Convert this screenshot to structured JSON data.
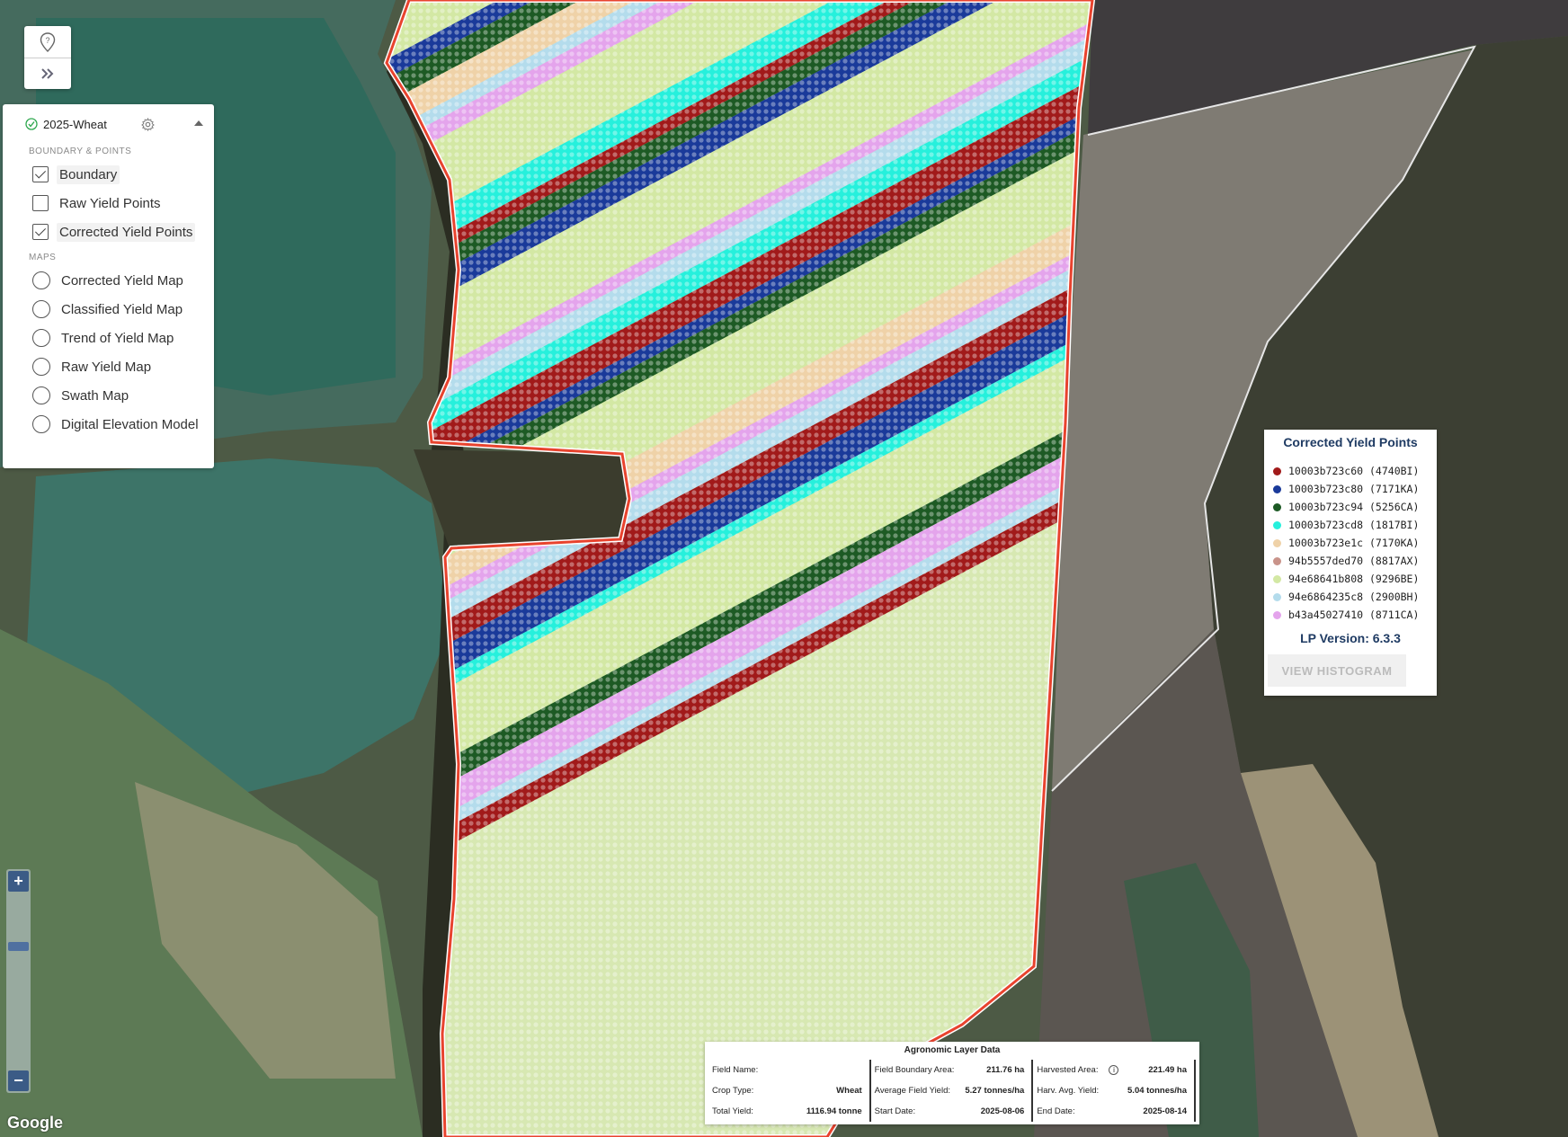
{
  "map": {
    "colors": {
      "boundary": "#e8432e",
      "fieldFill": "#d7e8b2"
    },
    "watermark": "Google"
  },
  "tools": {
    "location_help": "location-help-icon",
    "expand": "double-chevron-right-icon"
  },
  "layer_panel": {
    "title": "2025-Wheat",
    "sections": {
      "boundary_points": "BOUNDARY & POINTS",
      "maps": "MAPS"
    },
    "checkboxes": [
      {
        "label": "Boundary",
        "checked": true
      },
      {
        "label": "Raw Yield Points",
        "checked": false
      },
      {
        "label": "Corrected Yield Points",
        "checked": true
      }
    ],
    "radios": [
      {
        "label": "Corrected Yield Map"
      },
      {
        "label": "Classified Yield Map"
      },
      {
        "label": "Trend of Yield Map"
      },
      {
        "label": "Raw Yield Map"
      },
      {
        "label": "Swath Map"
      },
      {
        "label": "Digital Elevation Model"
      }
    ]
  },
  "zoom": {
    "plus": "+",
    "minus": "−"
  },
  "legend": {
    "title": "Corrected Yield Points",
    "items": [
      {
        "label": "10003b723c60 (4740BI)",
        "color": "#a11a1a"
      },
      {
        "label": "10003b723c80 (7171KA)",
        "color": "#1a3a9a"
      },
      {
        "label": "10003b723c94 (5256CA)",
        "color": "#1d5a24"
      },
      {
        "label": "10003b723cd8 (1817BI)",
        "color": "#26f0dc"
      },
      {
        "label": "10003b723e1c (7170KA)",
        "color": "#efd2a8"
      },
      {
        "label": "94b5557ded70 (8817AX)",
        "color": "#c9938a"
      },
      {
        "label": "94e68641b808 (9296BE)",
        "color": "#d3e8a4"
      },
      {
        "label": "94e6864235c8 (2900BH)",
        "color": "#b4dcec"
      },
      {
        "label": "b43a45027410 (8711CA)",
        "color": "#e4a4ec"
      }
    ],
    "version": "LP Version: 6.3.3",
    "histogram_button": "VIEW HISTOGRAM"
  },
  "agronomic": {
    "title": "Agronomic Layer Data",
    "col1": [
      {
        "label": "Field Name:",
        "value": ""
      },
      {
        "label": "Crop Type:",
        "value": "Wheat"
      },
      {
        "label": "Total Yield:",
        "value": "1116.94 tonne"
      }
    ],
    "col2": [
      {
        "label": "Field Boundary Area:",
        "value": "211.76 ha"
      },
      {
        "label": "Average Field Yield:",
        "value": "5.27 tonnes/ha"
      },
      {
        "label": "Start Date:",
        "value": "2025-08-06"
      }
    ],
    "col3": [
      {
        "label": "Harvested Area:",
        "value": "221.49 ha"
      },
      {
        "label": "Harv. Avg. Yield:",
        "value": "5.04 tonnes/ha"
      },
      {
        "label": "End Date:",
        "value": "2025-08-14"
      }
    ]
  }
}
